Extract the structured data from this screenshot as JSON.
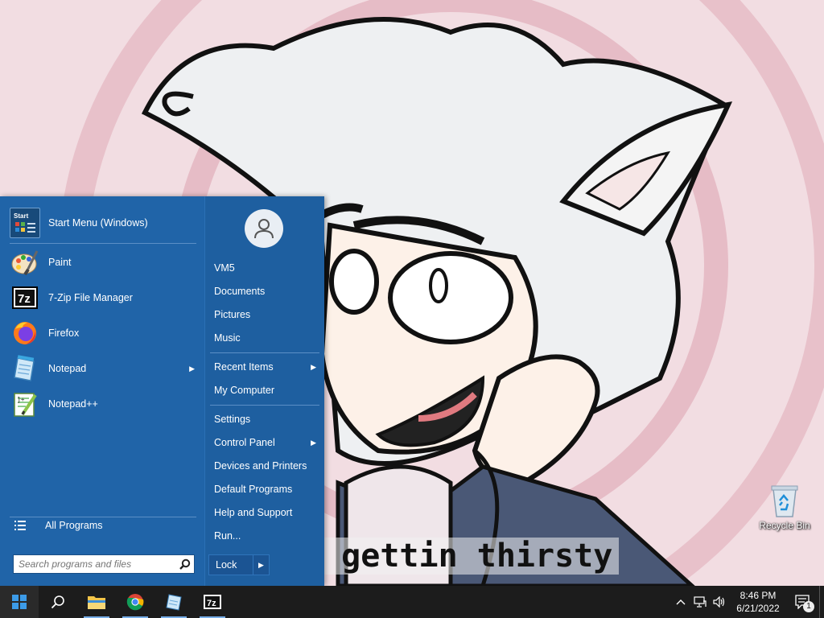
{
  "wallpaper": {
    "caption": "e gettin thirsty"
  },
  "desktop": {
    "recycle_bin_label": "Recycle Bin"
  },
  "start_menu": {
    "pinned": [
      {
        "label": "Start Menu (Windows)",
        "icon": "start-menu-icon"
      },
      {
        "label": "Paint",
        "icon": "paint-icon"
      },
      {
        "label": "7-Zip File Manager",
        "icon": "7zip-icon"
      },
      {
        "label": "Firefox",
        "icon": "firefox-icon"
      },
      {
        "label": "Notepad",
        "icon": "notepad-icon",
        "submenu": true
      },
      {
        "label": "Notepad++",
        "icon": "notepadpp-icon"
      }
    ],
    "all_programs_label": "All Programs",
    "search": {
      "placeholder": "Search programs and files"
    },
    "right": {
      "items": [
        {
          "label": "VM5"
        },
        {
          "label": "Documents"
        },
        {
          "label": "Pictures"
        },
        {
          "label": "Music"
        },
        {
          "label": "Recent Items",
          "submenu": true
        },
        {
          "label": "My Computer"
        },
        {
          "label": "Settings"
        },
        {
          "label": "Control Panel",
          "submenu": true
        },
        {
          "label": "Devices and Printers"
        },
        {
          "label": "Default Programs"
        },
        {
          "label": "Help and Support"
        },
        {
          "label": "Run..."
        }
      ],
      "lock_label": "Lock"
    }
  },
  "taskbar": {
    "time": "8:46 PM",
    "date": "6/21/2022",
    "notification_count": "1",
    "seven_zip_glyph": "7z"
  },
  "colors": {
    "start_menu_bg": "#2064a8",
    "taskbar_bg": "#1c1c1c",
    "accent": "#77aee8"
  }
}
